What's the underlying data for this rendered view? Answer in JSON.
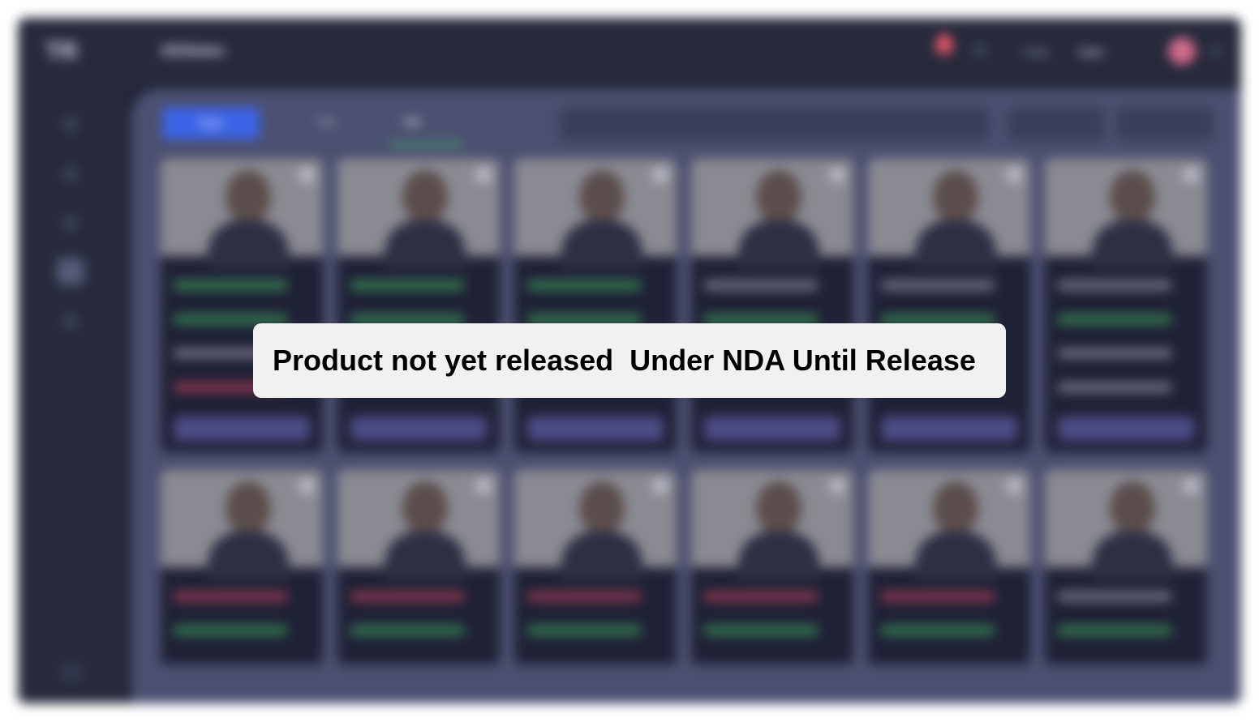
{
  "app": {
    "logo": "TR",
    "page_title": "Athletes",
    "user_label": "Hello",
    "user_name": "User",
    "colors": {
      "accent": "#3b63e6",
      "positive": "#45c267",
      "negative": "#e24a60",
      "notification": "#e8566b"
    }
  },
  "sidebar": {
    "items": [
      {
        "icon": "home-icon"
      },
      {
        "icon": "calendar-icon"
      },
      {
        "icon": "chart-icon"
      },
      {
        "icon": "users-icon",
        "active": true
      },
      {
        "icon": "settings-icon"
      }
    ]
  },
  "toolbar": {
    "filter_label": "Filter",
    "tabs": [
      "Tab",
      "Tab"
    ],
    "active_tab": 1,
    "search_placeholder": "",
    "select_1": "",
    "select_2": ""
  },
  "cards": [
    {
      "name": "",
      "role": "",
      "stats": [
        "green",
        "green",
        "grey",
        "red"
      ],
      "button": ""
    },
    {
      "name": "",
      "role": "",
      "stats": [
        "green",
        "green"
      ],
      "button": ""
    },
    {
      "name": "",
      "role": "",
      "stats": [
        "green",
        "green"
      ],
      "button": ""
    },
    {
      "name": "",
      "role": "",
      "stats": [
        "grey",
        "green"
      ],
      "button": ""
    },
    {
      "name": "",
      "role": "",
      "stats": [
        "grey",
        "green"
      ],
      "button": ""
    },
    {
      "name": "",
      "role": "",
      "stats": [
        "grey",
        "green",
        "grey",
        "grey"
      ],
      "button": ""
    },
    {
      "name": "",
      "role": "",
      "stats": [
        "red",
        "green"
      ]
    },
    {
      "name": "",
      "role": "",
      "stats": [
        "red",
        "green"
      ]
    },
    {
      "name": "",
      "role": "",
      "stats": [
        "red",
        "green"
      ]
    },
    {
      "name": "",
      "role": "",
      "stats": [
        "red",
        "green"
      ]
    },
    {
      "name": "",
      "role": "",
      "stats": [
        "red",
        "green"
      ]
    },
    {
      "name": "",
      "role": "",
      "stats": [
        "grey",
        "green"
      ]
    }
  ],
  "pagination": "",
  "banner": {
    "text": "Product not yet released  Under NDA Until Release"
  }
}
